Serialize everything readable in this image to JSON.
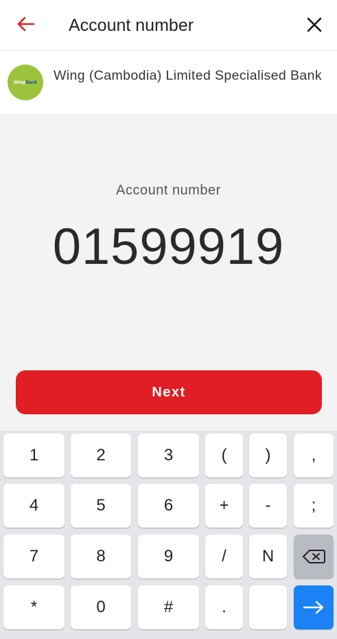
{
  "header": {
    "title": "Account number"
  },
  "bank": {
    "name": "Wing (Cambodia) Limited Specialised Bank",
    "logo_text_a": "Wing",
    "logo_text_b": "Bank"
  },
  "main": {
    "label": "Account number",
    "value": "01599919"
  },
  "actions": {
    "next_label": "Next"
  },
  "keyboard": {
    "keys": [
      "1",
      "2",
      "3",
      "(",
      ")",
      ",",
      "4",
      "5",
      "6",
      "+",
      "-",
      ";",
      "7",
      "8",
      "9",
      "/",
      "N",
      "*",
      "0",
      "#",
      "."
    ]
  },
  "colors": {
    "accent": "#e01e23",
    "keyboard_bg": "#e3e5e8",
    "enter_key": "#1a82f5",
    "logo_bg": "#9bc33c"
  }
}
